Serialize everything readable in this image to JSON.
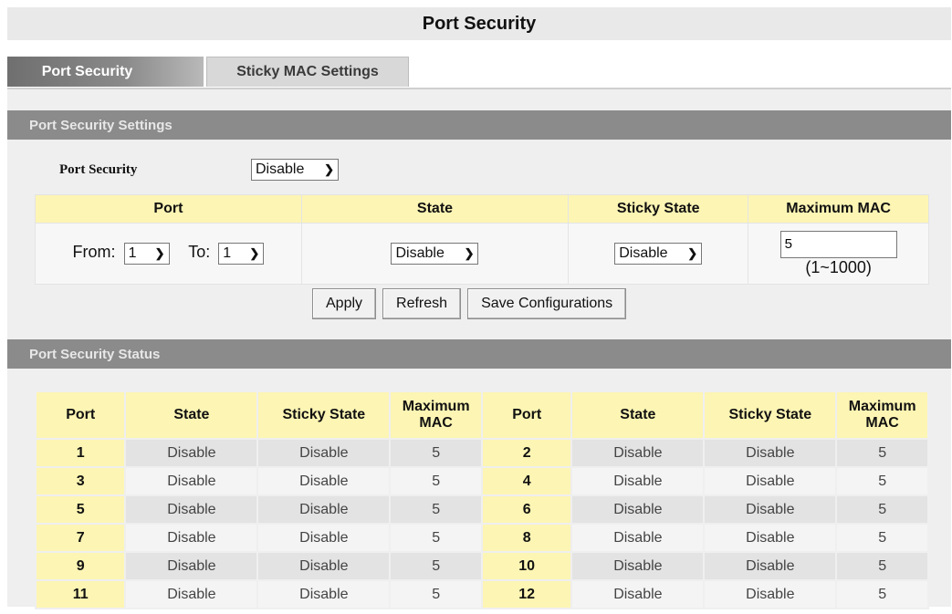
{
  "page_title": "Port Security",
  "tabs": [
    {
      "label": "Port Security",
      "active": true
    },
    {
      "label": "Sticky MAC Settings",
      "active": false
    }
  ],
  "settings": {
    "section_title": "Port Security Settings",
    "port_security_label": "Port Security",
    "port_security_value": "Disable",
    "headers": [
      "Port",
      "State",
      "Sticky State",
      "Maximum MAC"
    ],
    "from_label": "From:",
    "from_value": "1",
    "to_label": "To:",
    "to_value": "1",
    "state_value": "Disable",
    "sticky_state_value": "Disable",
    "max_mac_value": "5",
    "max_mac_range": "(1~1000)"
  },
  "buttons": {
    "apply": "Apply",
    "refresh": "Refresh",
    "save": "Save Configurations"
  },
  "status": {
    "section_title": "Port Security Status",
    "headers": [
      "Port",
      "State",
      "Sticky State",
      "Maximum MAC",
      "Port",
      "State",
      "Sticky State",
      "Maximum MAC"
    ],
    "rows": [
      [
        "1",
        "Disable",
        "Disable",
        "5",
        "2",
        "Disable",
        "Disable",
        "5"
      ],
      [
        "3",
        "Disable",
        "Disable",
        "5",
        "4",
        "Disable",
        "Disable",
        "5"
      ],
      [
        "5",
        "Disable",
        "Disable",
        "5",
        "6",
        "Disable",
        "Disable",
        "5"
      ],
      [
        "7",
        "Disable",
        "Disable",
        "5",
        "8",
        "Disable",
        "Disable",
        "5"
      ],
      [
        "9",
        "Disable",
        "Disable",
        "5",
        "10",
        "Disable",
        "Disable",
        "5"
      ],
      [
        "11",
        "Disable",
        "Disable",
        "5",
        "12",
        "Disable",
        "Disable",
        "5"
      ]
    ]
  },
  "colors": {
    "header_yellow": "#fdf5b4",
    "section_gray": "#8b8b8b",
    "panel_bg": "#efefef"
  }
}
